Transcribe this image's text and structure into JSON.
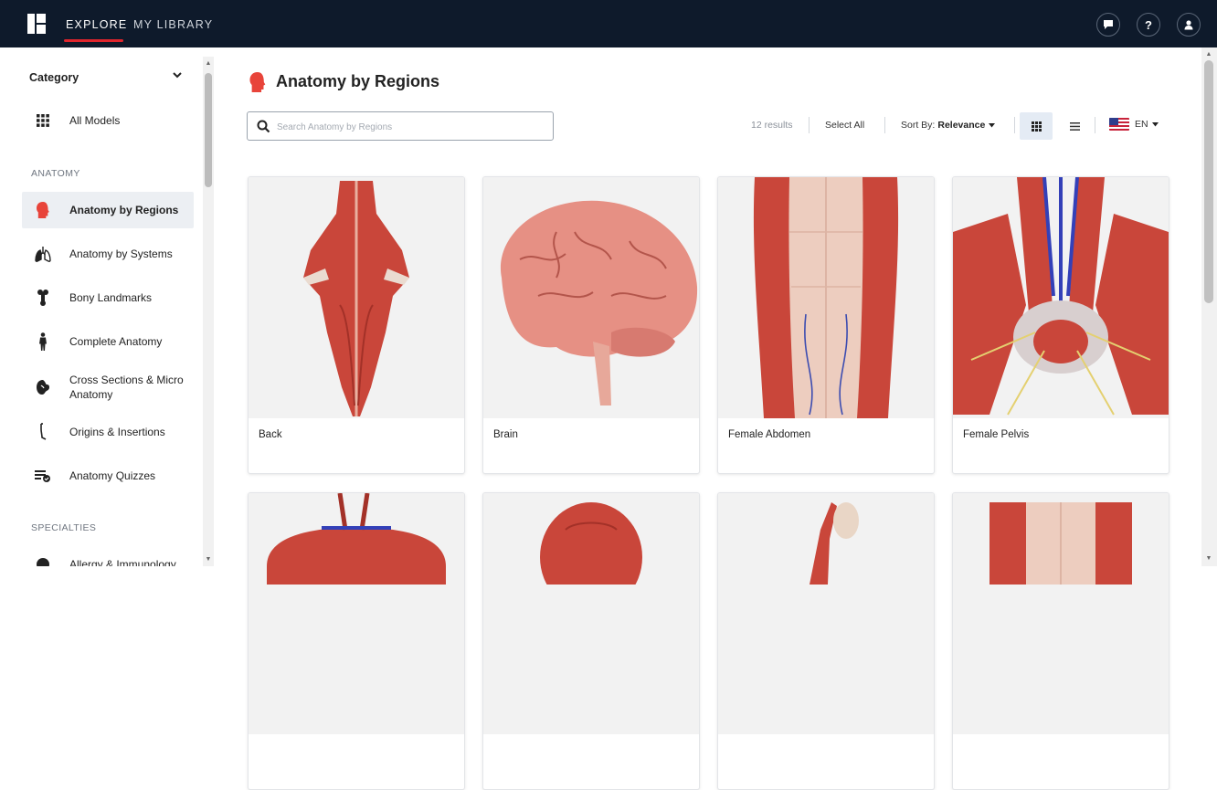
{
  "nav": {
    "tabs": [
      {
        "label": "EXPLORE",
        "active": true
      },
      {
        "label": "MY LIBRARY",
        "active": false
      }
    ],
    "icons": [
      "chat-icon",
      "help-icon",
      "user-icon"
    ]
  },
  "sidebar": {
    "category_label": "Category",
    "all_models_label": "All Models",
    "sections": [
      {
        "label": "ANATOMY",
        "items": [
          {
            "label": "Anatomy by Regions",
            "icon": "head-icon",
            "active": true
          },
          {
            "label": "Anatomy by Systems",
            "icon": "lungs-icon",
            "active": false
          },
          {
            "label": "Bony Landmarks",
            "icon": "bone-icon",
            "active": false
          },
          {
            "label": "Complete Anatomy",
            "icon": "body-icon",
            "active": false
          },
          {
            "label": "Cross Sections & Micro Anatomy",
            "icon": "kidney-icon",
            "active": false
          },
          {
            "label": "Origins & Insertions",
            "icon": "muscle-icon",
            "active": false
          },
          {
            "label": "Anatomy Quizzes",
            "icon": "quiz-icon",
            "active": false
          }
        ]
      },
      {
        "label": "SPECIALTIES",
        "items": [
          {
            "label": "Allergy & Immunology",
            "icon": "allergy-icon",
            "active": false
          }
        ]
      }
    ]
  },
  "main": {
    "title": "Anatomy by Regions",
    "search_placeholder": "Search Anatomy by Regions",
    "results_text": "12 results",
    "select_all_label": "Select All",
    "sort_label": "Sort By:",
    "sort_value": "Relevance",
    "language": "EN",
    "view_mode": "grid",
    "colors": {
      "accent": "#e0252c",
      "nav_bg": "#0e1a2b",
      "muscle": "#c9463a"
    }
  },
  "cards": [
    {
      "title": "Back"
    },
    {
      "title": "Brain"
    },
    {
      "title": "Female Abdomen"
    },
    {
      "title": "Female Pelvis"
    },
    {
      "title": ""
    },
    {
      "title": ""
    },
    {
      "title": ""
    },
    {
      "title": ""
    }
  ]
}
